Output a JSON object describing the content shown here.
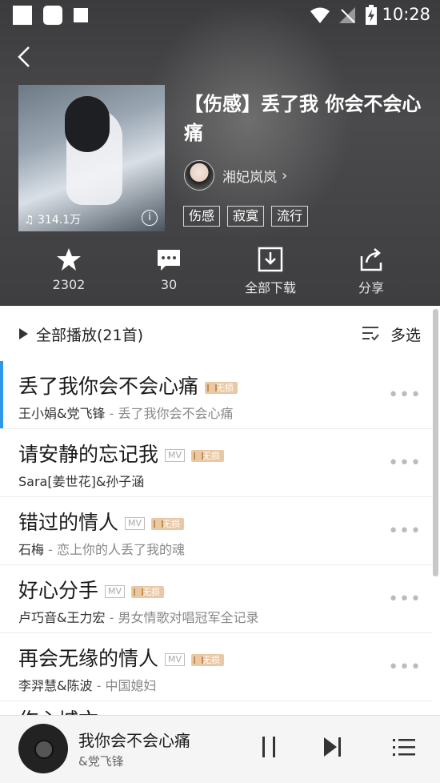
{
  "status_bar": {
    "time": "10:28"
  },
  "playlist": {
    "title": "【伤感】丢了我  你会不会心痛",
    "play_count": "314.1万",
    "author": "湘妃岚岚",
    "tags": [
      "伤感",
      "寂寞",
      "流行"
    ]
  },
  "actions": {
    "favorite": "2302",
    "comment": "30",
    "download": "全部下载",
    "share": "分享"
  },
  "toolbar": {
    "play_all": "全部播放(21首)",
    "multi_select": "多选"
  },
  "songs": [
    {
      "name": "丢了我你会不会心痛",
      "artist": "王小娟&党飞锋",
      "album": "丢了我你会不会心痛",
      "mv": false,
      "badge": "无损"
    },
    {
      "name": "请安静的忘记我",
      "artist": "Sara[姜世花]&孙子涵",
      "album": "",
      "mv": true,
      "badge": "无损"
    },
    {
      "name": "错过的情人",
      "artist": "石梅",
      "album": "恋上你的人丢了我的魂",
      "mv": true,
      "badge": "无损"
    },
    {
      "name": "好心分手",
      "artist": "卢巧音&王力宏",
      "album": "男女情歌对唱冠军全记录",
      "mv": true,
      "badge": "无损"
    },
    {
      "name": "再会无缘的情人",
      "artist": "李羿慧&陈波",
      "album": "中国媳妇",
      "mv": true,
      "badge": "无损"
    }
  ],
  "partial_row": "作心城亡",
  "mv_label": "MV",
  "now_playing": {
    "title": "我你会不会心痛",
    "artist": "&党飞锋"
  }
}
